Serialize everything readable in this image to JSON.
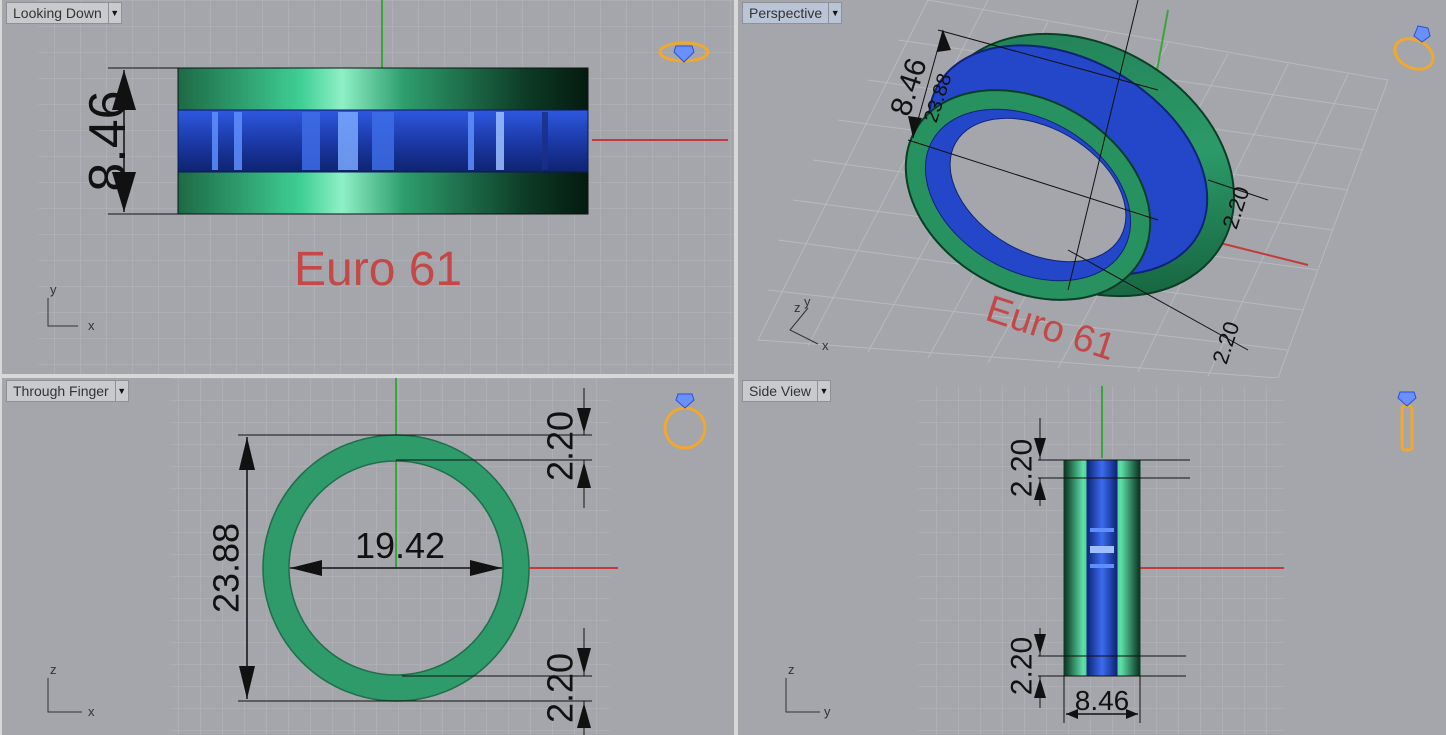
{
  "viewports": {
    "top": {
      "label": "Looking Down",
      "dim_height": "8.46",
      "text": "Euro 61",
      "axis_v": "y",
      "axis_h": "x"
    },
    "perspective": {
      "label": "Perspective",
      "dim_a": "8.46",
      "dim_b": "23.88",
      "dim_c": "2.20",
      "dim_d": "2.20",
      "text": "Euro 61",
      "axis_v": "y",
      "axis_z": "z",
      "axis_h": "x"
    },
    "front": {
      "label": "Through Finger",
      "dim_outer": "23.88",
      "dim_inner": "19.42",
      "dim_top": "2.20",
      "dim_bottom": "2.20",
      "axis_v": "z",
      "axis_h": "x"
    },
    "side": {
      "label": "Side View",
      "dim_top": "2.20",
      "dim_bottom": "2.20",
      "dim_width": "8.46",
      "axis_v": "z",
      "axis_h": "y"
    }
  },
  "icons": [
    "diamond-ring-flat-icon",
    "ring-perspective-icon",
    "ring-front-icon",
    "ring-side-icon"
  ],
  "colors": {
    "viewport_bg": "#a4a6ab",
    "grid": "#b5b7bb",
    "ring_green": "#2f9a6a",
    "channel_blue": "#2747c9",
    "euro_text": "#c44848",
    "axis_red": "#c43a3a",
    "axis_green": "#3aa53a"
  }
}
